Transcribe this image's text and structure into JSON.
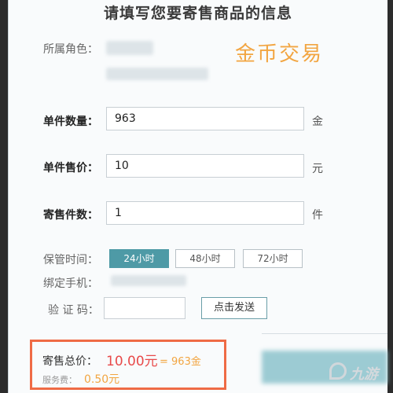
{
  "form": {
    "title": "请填写您要寄售商品的信息",
    "role_label": "所属角色：",
    "badge": "金币交易",
    "unit_qty_label": "单件数量：",
    "unit_qty_value": "963",
    "unit_qty_unit": "金",
    "unit_price_label": "单件售价：",
    "unit_price_value": "10",
    "unit_price_unit": "元",
    "count_label": "寄售件数：",
    "count_value": "1",
    "count_unit": "件",
    "keep_label": "保管时间：",
    "keep_options": [
      "24小时",
      "48小时",
      "72小时"
    ],
    "keep_selected": "24小时",
    "phone_label": "绑定手机：",
    "code_label": "验 证 码：",
    "code_placeholder": "",
    "send_button": "点击发送"
  },
  "summary": {
    "total_label": "寄售总价：",
    "total_amount": "10.00元",
    "total_equals": "= 963金",
    "fee_label": "服务费：",
    "fee_amount": "0.50元"
  },
  "watermark": {
    "text": "九游"
  },
  "colors": {
    "accent": "#4e9aa6",
    "badge": "#f2a541",
    "highlight_border": "#ef6b45",
    "total_red": "#e84a4a",
    "gold": "#f2a541"
  }
}
